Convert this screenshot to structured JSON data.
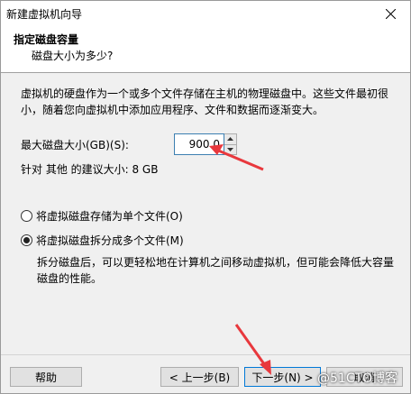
{
  "window": {
    "title": "新建虚拟机向导"
  },
  "header": {
    "title": "指定磁盘容量",
    "subtitle": "磁盘大小为多少?"
  },
  "description": "虚拟机的硬盘作为一个或多个文件存储在主机的物理磁盘中。这些文件最初很小，随着您向虚拟机中添加应用程序、文件和数据而逐渐变大。",
  "disk_size": {
    "label": "最大磁盘大小(GB)(S):",
    "value": "900.0"
  },
  "recommend": "针对 其他 的建议大小: 8 GB",
  "options": {
    "single_label": "将虚拟磁盘存储为单个文件(O)",
    "split_label": "将虚拟磁盘拆分成多个文件(M)",
    "selected": "split",
    "split_description": "拆分磁盘后，可以更轻松地在计算机之间移动虚拟机，但可能会降低大容量磁盘的性能。"
  },
  "buttons": {
    "help": "帮助",
    "back": "< 上一步(B)",
    "next": "下一步(N) >",
    "cancel": "取消"
  },
  "watermark": "@51CTO博客",
  "colors": {
    "arrow": "#e8383d",
    "focus": "#0078d7"
  }
}
